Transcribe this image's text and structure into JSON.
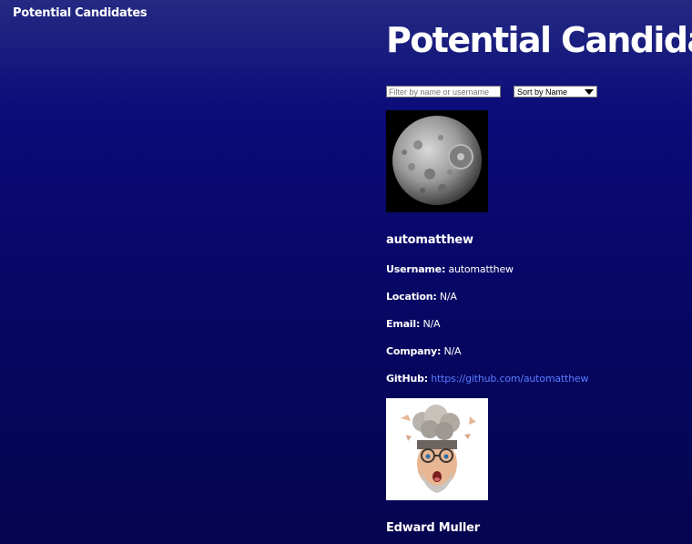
{
  "nav": {
    "title": "Potential Candidates"
  },
  "main": {
    "title": "Potential Candidates",
    "filter": {
      "placeholder": "Filter by name or username",
      "value": ""
    },
    "sort": {
      "selected": "Sort by Name"
    }
  },
  "candidates": [
    {
      "name": "automatthew",
      "avatar_icon": "moon-photo",
      "username_label": "Username:",
      "username": "automatthew",
      "location_label": "Location:",
      "location": "N/A",
      "email_label": "Email:",
      "email": "N/A",
      "company_label": "Company:",
      "company": "N/A",
      "github_label": "GitHub:",
      "github": "https://github.com/automatthew"
    },
    {
      "name": "Edward Muller",
      "avatar_icon": "mind-blown-memoji"
    }
  ],
  "colors": {
    "background_top": "#242a82",
    "background_bottom": "#050550",
    "link": "#5a7cff",
    "text": "#ffffff"
  }
}
